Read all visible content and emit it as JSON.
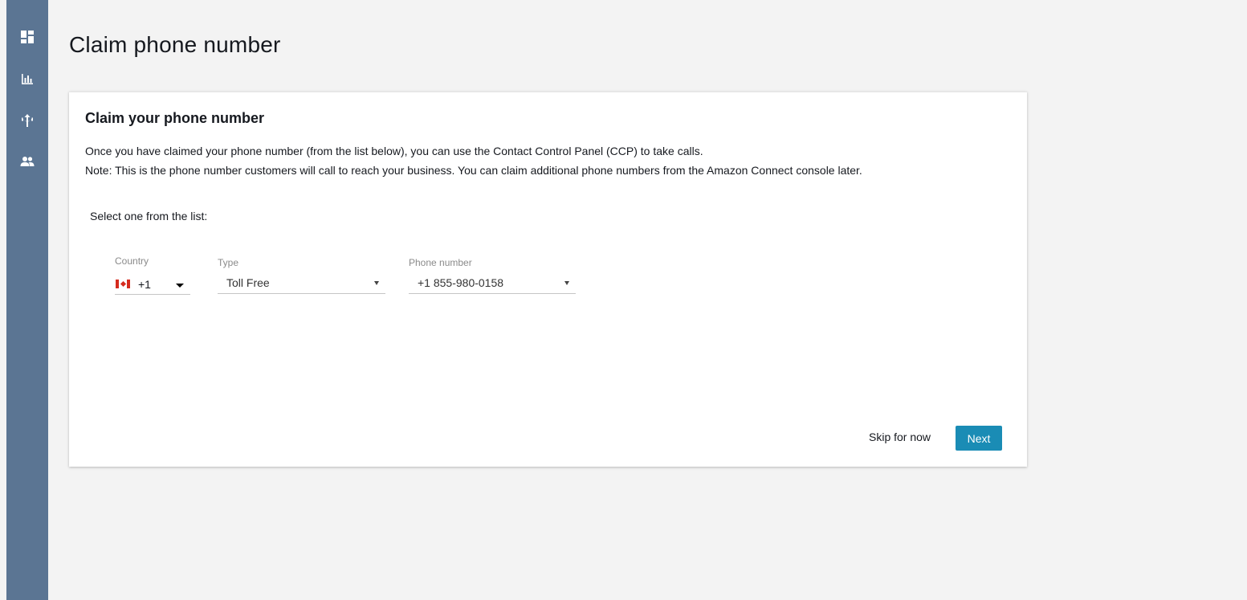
{
  "sidebar": {
    "items": [
      {
        "icon": "dashboard-icon"
      },
      {
        "icon": "metrics-icon"
      },
      {
        "icon": "routing-icon"
      },
      {
        "icon": "users-icon"
      }
    ]
  },
  "page": {
    "title": "Claim phone number"
  },
  "card": {
    "title": "Claim your phone number",
    "description_line1": "Once you have claimed your phone number (from the list below), you can use the Contact Control Panel (CCP) to take calls.",
    "description_line2": "Note: This is the phone number customers will call to reach your business. You can claim additional phone numbers from the Amazon Connect console later.",
    "select_label": "Select one from the list:"
  },
  "form": {
    "country": {
      "label": "Country",
      "code": "+1",
      "flag": "canada-flag"
    },
    "type": {
      "label": "Type",
      "value": "Toll Free"
    },
    "phone": {
      "label": "Phone number",
      "value": "+1 855-980-0158"
    }
  },
  "actions": {
    "skip_label": "Skip for now",
    "next_label": "Next"
  },
  "colors": {
    "sidebar": "#5b7593",
    "primary_button": "#1a8cb5",
    "background": "#f3f3f3"
  }
}
